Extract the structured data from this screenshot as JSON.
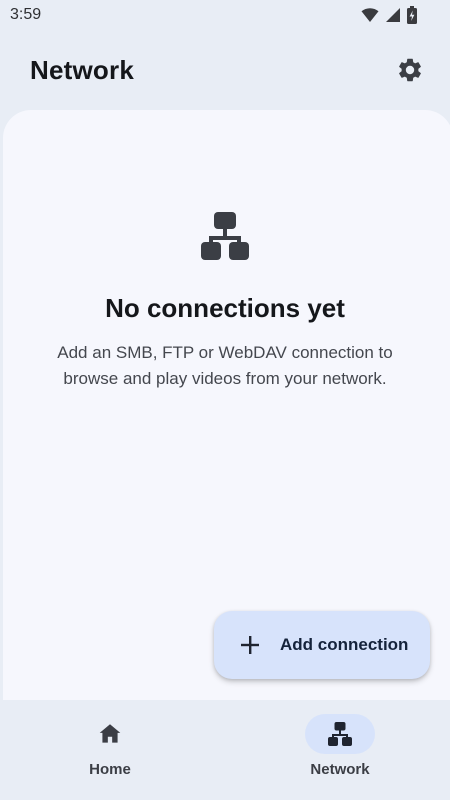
{
  "status_bar": {
    "time": "3:59",
    "icons": [
      "wifi-icon",
      "cell-signal-icon",
      "battery-charging-icon"
    ]
  },
  "header": {
    "title": "Network",
    "settings_icon": "gear-icon"
  },
  "empty_state": {
    "icon": "network-icon",
    "title": "No connections yet",
    "description": "Add an SMB, FTP or WebDAV connection to browse and play videos from your network."
  },
  "fab": {
    "icon": "plus-icon",
    "label": "Add connection"
  },
  "bottom_nav": {
    "items": [
      {
        "label": "Home",
        "icon": "home-icon",
        "selected": false
      },
      {
        "label": "Network",
        "icon": "network-icon",
        "selected": true
      }
    ]
  },
  "colors": {
    "background": "#e8edf5",
    "surface": "#f6f7fd",
    "accent_container": "#d7e3fb",
    "icon": "#3b3e45"
  }
}
